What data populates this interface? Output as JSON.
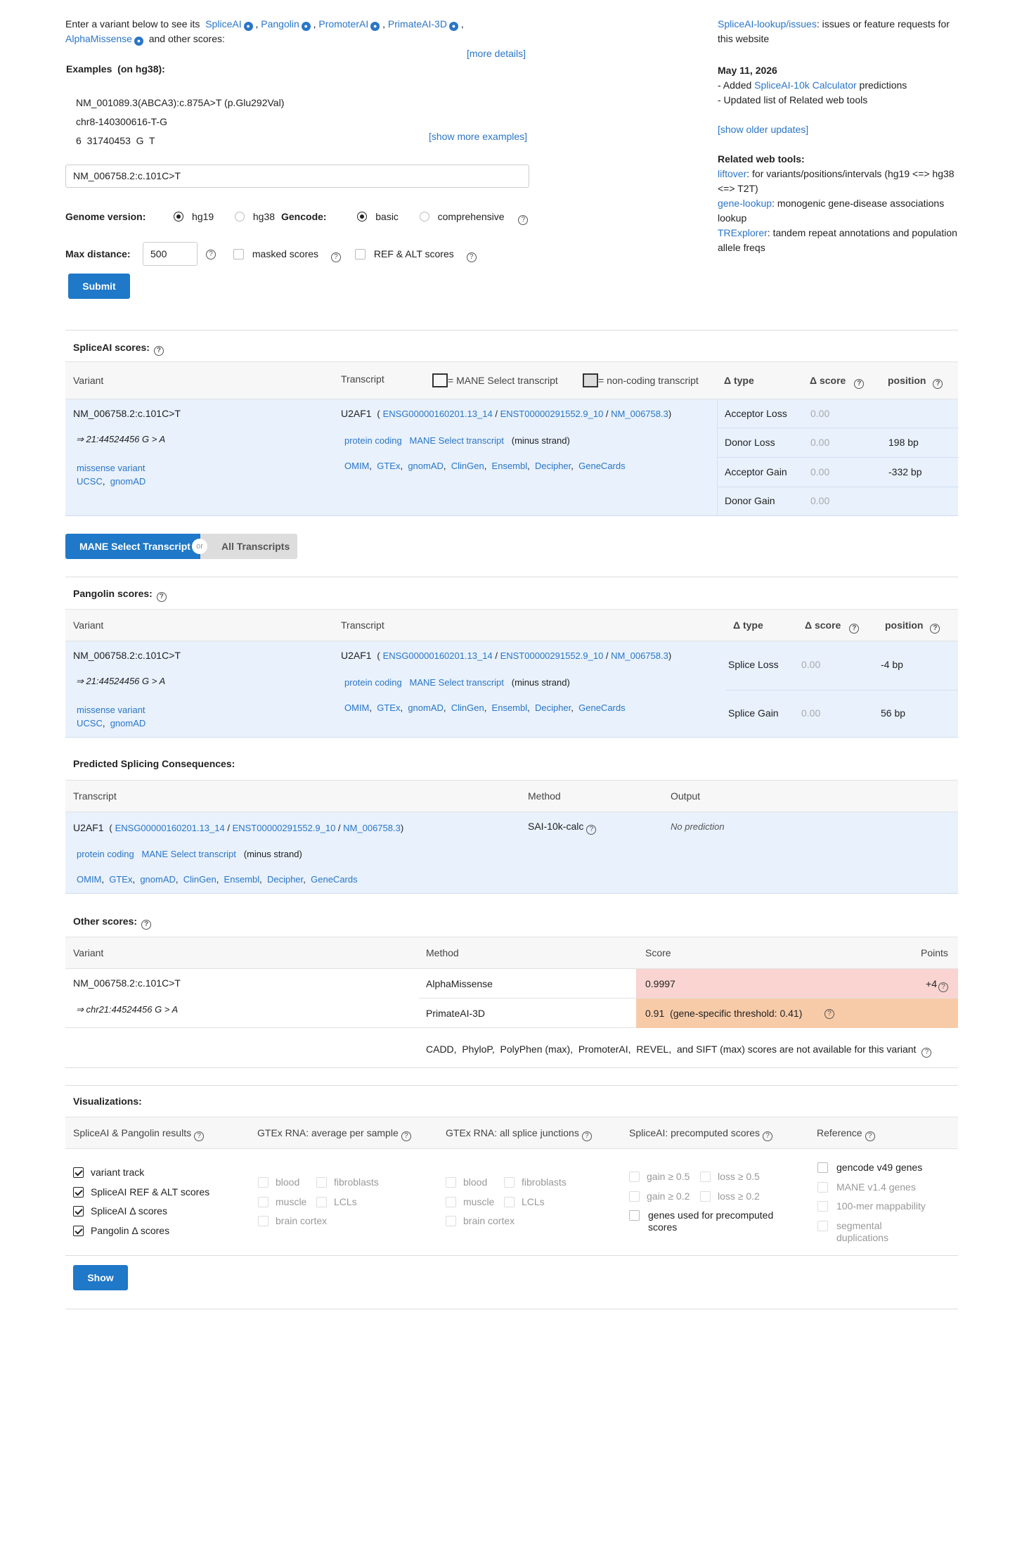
{
  "intro": {
    "line1_prefix": "Enter a variant below to see its",
    "tools": [
      "SpliceAI",
      "Pangolin",
      "PromoterAI",
      "PrimateAI-3D",
      "AlphaMissense"
    ],
    "line2_suffix": "and other scores:",
    "more_details": "[more details]"
  },
  "examples": {
    "title": "Examples",
    "title_note": "(on hg38):",
    "items": [
      "NM_001089.3(ABCA3):c.875A>T (p.Glu292Val)",
      "chr8-140300616-T-G",
      "6  31740453  G  T"
    ],
    "show_more": "[show more examples]"
  },
  "search": {
    "value": "NM_006758.2:c.101C>T"
  },
  "options": {
    "genome_label": "Genome version:",
    "genome_options": [
      "hg19",
      "hg38"
    ],
    "genome_selected": "hg19",
    "gencode_label": "Gencode:",
    "gencode_options": [
      "basic",
      "comprehensive"
    ],
    "gencode_selected": "basic",
    "maxdist_label": "Max distance:",
    "maxdist_value": "500",
    "masked_label": "masked scores",
    "refalt_label": "REF & ALT scores",
    "submit": "Submit"
  },
  "sidebar": {
    "issues_link": "SpliceAI-lookup/issues",
    "issues_text": ": issues or feature requests for this website",
    "date": "May 11, 2026",
    "update1_prefix": "- Added ",
    "update1_link": "SpliceAI-10k Calculator",
    "update1_suffix": " predictions",
    "update2": "- Updated list of Related web tools",
    "show_older": "[show older updates]",
    "related_title": "Related web tools:",
    "related": [
      {
        "name": "liftover",
        "text": ": for variants/positions/intervals (hg19 <=> hg38 <=> T2T)"
      },
      {
        "name": "gene-lookup",
        "text": ": monogenic gene-disease associations lookup"
      },
      {
        "name": "TRExplorer",
        "text": ": tandem repeat annotations and population allele freqs"
      }
    ]
  },
  "transcript": {
    "gene": "U2AF1",
    "ensg": "ENSG00000160201.13_14",
    "enst": "ENST00000291552.9_10",
    "nm": "NM_006758.3",
    "biotype": "protein coding",
    "mane": "MANE Select transcript",
    "strand": "(minus strand)",
    "links": [
      "OMIM",
      "GTEx",
      "gnomAD",
      "ClinGen",
      "Ensembl",
      "Decipher",
      "GeneCards"
    ]
  },
  "variant": {
    "hgvs": "NM_006758.2:c.101C>T",
    "coord": "⇒ 21:44524456 G > A",
    "coord_chr": "⇒ chr21:44524456 G > A",
    "consequence": "missense variant",
    "links": [
      "UCSC",
      "gnomAD"
    ]
  },
  "spliceai": {
    "title": "SpliceAI scores:",
    "headers": {
      "variant": "Variant",
      "transcript": "Transcript",
      "mane_legend": "= MANE Select transcript",
      "noncoding_legend": "= non-coding transcript",
      "type": "Δ type",
      "score": "Δ score",
      "position": "position"
    },
    "rows": [
      {
        "type": "Acceptor Loss",
        "score": "0.00",
        "position": ""
      },
      {
        "type": "Donor Loss",
        "score": "0.00",
        "position": "198 bp"
      },
      {
        "type": "Acceptor Gain",
        "score": "0.00",
        "position": "-332 bp"
      },
      {
        "type": "Donor Gain",
        "score": "0.00",
        "position": ""
      }
    ]
  },
  "toggle": {
    "left": "MANE Select Transcript",
    "or": "or",
    "right": "All Transcripts"
  },
  "pangolin": {
    "title": "Pangolin scores:",
    "headers": {
      "variant": "Variant",
      "transcript": "Transcript",
      "type": "Δ type",
      "score": "Δ score",
      "position": "position"
    },
    "rows": [
      {
        "type": "Splice Loss",
        "score": "0.00",
        "position": "-4 bp"
      },
      {
        "type": "Splice Gain",
        "score": "0.00",
        "position": "56 bp"
      }
    ]
  },
  "consequences": {
    "title": "Predicted Splicing Consequences:",
    "headers": {
      "transcript": "Transcript",
      "method": "Method",
      "output": "Output"
    },
    "method": "SAI-10k-calc",
    "output": "No prediction"
  },
  "other": {
    "title": "Other scores:",
    "headers": {
      "variant": "Variant",
      "method": "Method",
      "score": "Score",
      "points": "Points"
    },
    "rows": [
      {
        "method": "AlphaMissense",
        "score": "0.9997",
        "points": "+4",
        "color": "#f9d4d0"
      },
      {
        "method": "PrimateAI-3D",
        "score": "0.91  (gene-specific threshold: 0.41)",
        "points": "",
        "color": "#f8cba8"
      }
    ],
    "note": "CADD,  PhyloP,  PolyPhen (max),  PromoterAI,  REVEL,  and SIFT (max) scores are not available for this variant"
  },
  "viz": {
    "title": "Visualizations:",
    "cols": [
      {
        "header": "SpliceAI & Pangolin results",
        "items": [
          "variant track",
          "SpliceAI REF & ALT scores",
          "SpliceAI Δ  scores",
          "Pangolin Δ  scores"
        ]
      },
      {
        "header": "GTEx RNA: average per sample",
        "items": [
          "blood",
          "fibroblasts",
          "muscle",
          "LCLs",
          "brain cortex"
        ]
      },
      {
        "header": "GTEx RNA: all splice junctions",
        "items": [
          "blood",
          "fibroblasts",
          "muscle",
          "LCLs",
          "brain cortex"
        ]
      },
      {
        "header": "SpliceAI: precomputed scores",
        "items": [
          "gain ≥ 0.5",
          "loss ≥ 0.5",
          "gain ≥ 0.2",
          "loss ≥ 0.2",
          "genes used for precomputed scores"
        ]
      },
      {
        "header": "Reference",
        "items": [
          "gencode v49 genes",
          "MANE v1.4 genes",
          "100-mer mappability",
          "segmental duplications"
        ]
      }
    ],
    "show": "Show"
  }
}
